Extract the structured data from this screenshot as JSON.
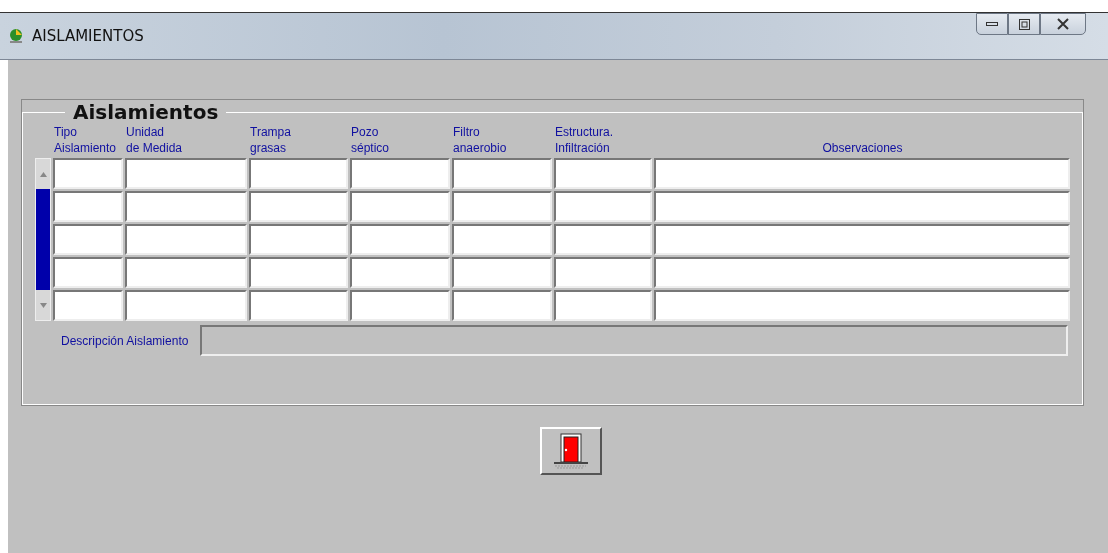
{
  "window": {
    "title": "AISLAMIENTOS"
  },
  "group": {
    "title": "Aislamientos"
  },
  "table": {
    "columns": [
      {
        "line1": "Tipo",
        "line2": "Aislamiento"
      },
      {
        "line1": "Unidad",
        "line2": "de Medida"
      },
      {
        "line1": "Trampa",
        "line2": "grasas"
      },
      {
        "line1": "Pozo",
        "line2": "séptico"
      },
      {
        "line1": "Filtro",
        "line2": "anaerobio"
      },
      {
        "line1": "Estructura.",
        "line2": "Infiltración"
      },
      {
        "line2": "Observaciones"
      }
    ]
  },
  "description": {
    "label": "Descripción Aislamiento"
  }
}
